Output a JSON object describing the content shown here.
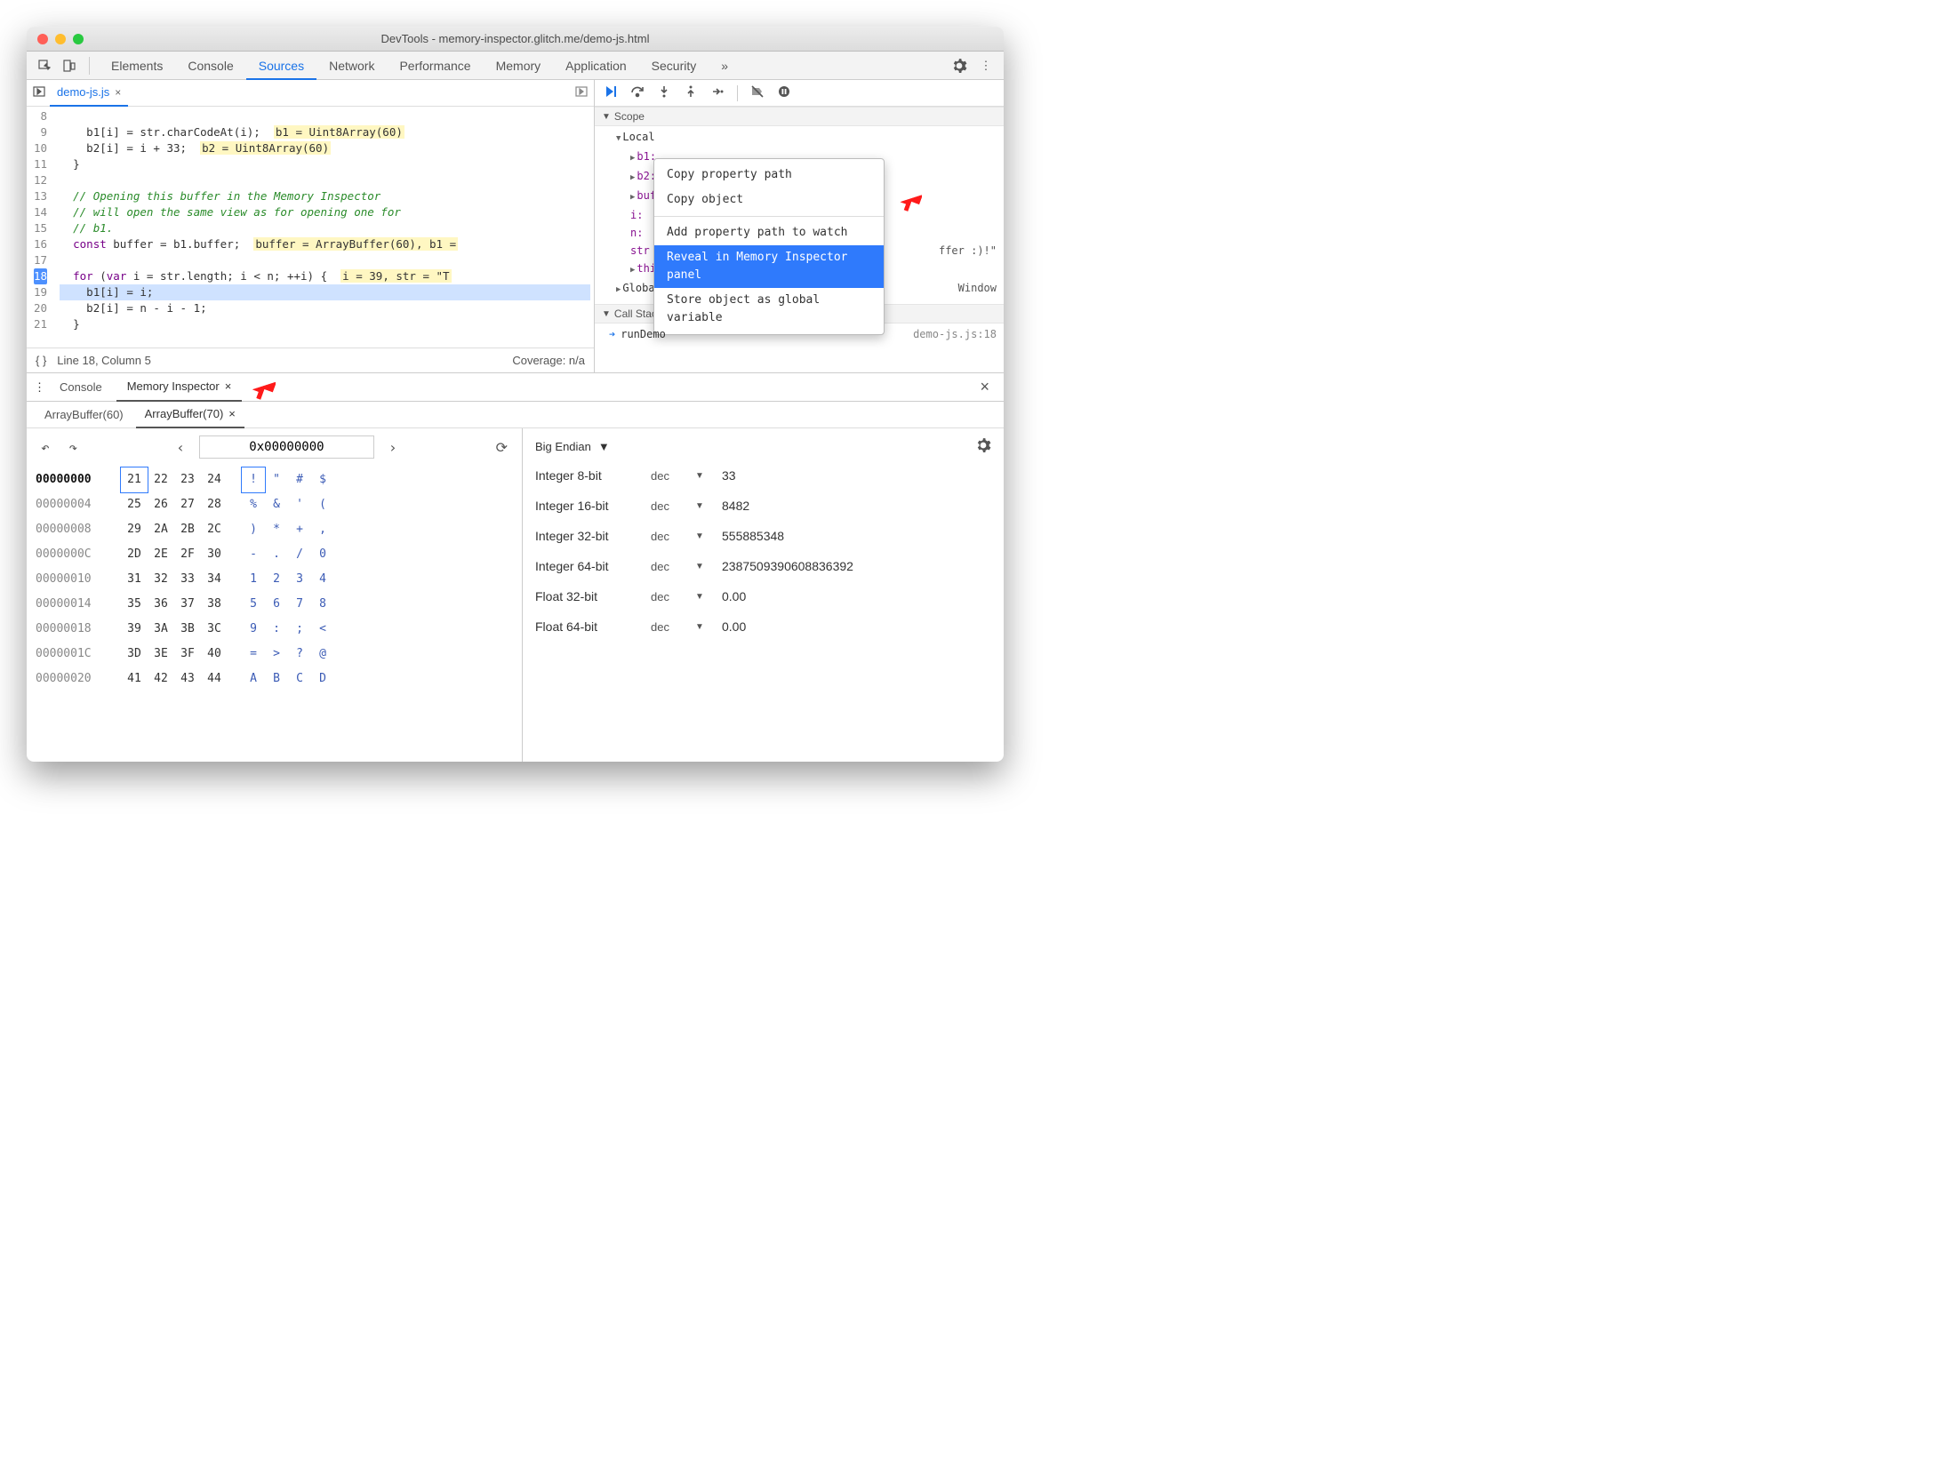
{
  "titlebar": {
    "title": "DevTools - memory-inspector.glitch.me/demo-js.html"
  },
  "tabs": [
    "Elements",
    "Console",
    "Sources",
    "Network",
    "Performance",
    "Memory",
    "Application",
    "Security"
  ],
  "active_tab": "Sources",
  "file_tab": {
    "name": "demo-js.js",
    "closeable": true
  },
  "gutter_lines": [
    "8",
    "9",
    "10",
    "11",
    "12",
    "13",
    "14",
    "15",
    "16",
    "17",
    "18",
    "19",
    "20",
    "21"
  ],
  "code": {
    "l8": "    b1[i] = str.charCodeAt(i);  ",
    "l8hint": "b1 = Uint8Array(60)",
    "l9": "    b2[i] = i + 33;  ",
    "l9hint": "b2 = Uint8Array(60)",
    "l10": "  }",
    "l12": "  // Opening this buffer in the Memory Inspector",
    "l13": "  // will open the same view as for opening one for",
    "l14": "  // b1.",
    "l15a": "  const buffer = b1.buffer;  ",
    "l15hint": "buffer = ArrayBuffer(60), b1 =",
    "l17a": "  for (var i = str.length; i < n; ++i) {  ",
    "l17hint": "i = 39, str = \"T",
    "l18": "    b1[i] = i;",
    "l19": "    b2[i] = n - i - 1;",
    "l20": "  }"
  },
  "status_bar": {
    "brace": "{ }",
    "pos": "Line 18, Column 5",
    "coverage": "Coverage: n/a"
  },
  "scope": {
    "header": "Scope",
    "local_label": "Local",
    "rows": {
      "b1": "b1: …",
      "b2": "b2: …",
      "buff": "buff",
      "i": "i: ",
      "n": "n: ",
      "str": "str",
      "ffer_tail": "ffer :)!\"",
      "this": "this"
    },
    "global": "Global",
    "global_val": "Window"
  },
  "callstack": {
    "header": "Call Stack",
    "fn": "runDemo",
    "loc": "demo-js.js:18"
  },
  "context_menu": {
    "copy_path": "Copy property path",
    "copy_obj": "Copy object",
    "add_watch": "Add property path to watch",
    "reveal": "Reveal in Memory Inspector panel",
    "store": "Store object as global variable"
  },
  "drawer_tabs": {
    "console": "Console",
    "mem": "Memory Inspector"
  },
  "mem_tabs": {
    "ab60": "ArrayBuffer(60)",
    "ab70": "ArrayBuffer(70)"
  },
  "addr_bar": {
    "value": "0x00000000"
  },
  "hex": {
    "rows": [
      {
        "addr": "00000000",
        "bytes": [
          "21",
          "22",
          "23",
          "24"
        ],
        "ascii": [
          "!",
          "\"",
          "#",
          "$"
        ]
      },
      {
        "addr": "00000004",
        "bytes": [
          "25",
          "26",
          "27",
          "28"
        ],
        "ascii": [
          "%",
          "&",
          "'",
          "("
        ]
      },
      {
        "addr": "00000008",
        "bytes": [
          "29",
          "2A",
          "2B",
          "2C"
        ],
        "ascii": [
          ")",
          "*",
          "+",
          ","
        ]
      },
      {
        "addr": "0000000C",
        "bytes": [
          "2D",
          "2E",
          "2F",
          "30"
        ],
        "ascii": [
          "-",
          ".",
          "/",
          "0"
        ]
      },
      {
        "addr": "00000010",
        "bytes": [
          "31",
          "32",
          "33",
          "34"
        ],
        "ascii": [
          "1",
          "2",
          "3",
          "4"
        ]
      },
      {
        "addr": "00000014",
        "bytes": [
          "35",
          "36",
          "37",
          "38"
        ],
        "ascii": [
          "5",
          "6",
          "7",
          "8"
        ]
      },
      {
        "addr": "00000018",
        "bytes": [
          "39",
          "3A",
          "3B",
          "3C"
        ],
        "ascii": [
          "9",
          ":",
          ";",
          "<"
        ]
      },
      {
        "addr": "0000001C",
        "bytes": [
          "3D",
          "3E",
          "3F",
          "40"
        ],
        "ascii": [
          "=",
          ">",
          "?",
          "@"
        ]
      },
      {
        "addr": "00000020",
        "bytes": [
          "41",
          "42",
          "43",
          "44"
        ],
        "ascii": [
          "A",
          "B",
          "C",
          "D"
        ]
      }
    ]
  },
  "endian": "Big Endian",
  "values": [
    {
      "label": "Integer 8-bit",
      "fmt": "dec",
      "val": "33"
    },
    {
      "label": "Integer 16-bit",
      "fmt": "dec",
      "val": "8482"
    },
    {
      "label": "Integer 32-bit",
      "fmt": "dec",
      "val": "555885348"
    },
    {
      "label": "Integer 64-bit",
      "fmt": "dec",
      "val": "2387509390608836392"
    },
    {
      "label": "Float 32-bit",
      "fmt": "dec",
      "val": "0.00"
    },
    {
      "label": "Float 64-bit",
      "fmt": "dec",
      "val": "0.00"
    }
  ]
}
